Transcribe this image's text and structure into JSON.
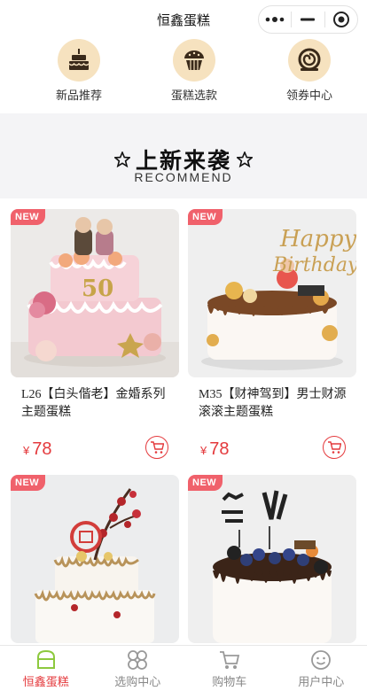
{
  "app": {
    "title": "恒鑫蛋糕"
  },
  "quick_nav": [
    {
      "label": "新品推荐",
      "icon": "cake-icon"
    },
    {
      "label": "蛋糕选款",
      "icon": "cupcake-icon"
    },
    {
      "label": "领券中心",
      "icon": "roll-cake-icon"
    }
  ],
  "section": {
    "title": "上新来袭",
    "subtitle": "RECOMMEND"
  },
  "products": [
    {
      "tag": "NEW",
      "name": "L26【白头偕老】金婚系列主题蛋糕",
      "currency": "¥",
      "price": "78"
    },
    {
      "tag": "NEW",
      "name": "M35【财神驾到】男士财源滚滚主题蛋糕",
      "currency": "¥",
      "price": "78"
    },
    {
      "tag": "NEW",
      "name": "",
      "currency": "",
      "price": ""
    },
    {
      "tag": "NEW",
      "name": "",
      "currency": "",
      "price": ""
    }
  ],
  "tabbar": [
    {
      "label": "恒鑫蛋糕",
      "icon": "home-icon",
      "active": true
    },
    {
      "label": "选购中心",
      "icon": "grid-icon",
      "active": false
    },
    {
      "label": "购物车",
      "icon": "cart-icon",
      "active": false
    },
    {
      "label": "用户中心",
      "icon": "user-icon",
      "active": false
    }
  ],
  "colors": {
    "accent": "#e4393c",
    "tag": "#f0616b",
    "nav_circle": "#f6e2bf"
  }
}
